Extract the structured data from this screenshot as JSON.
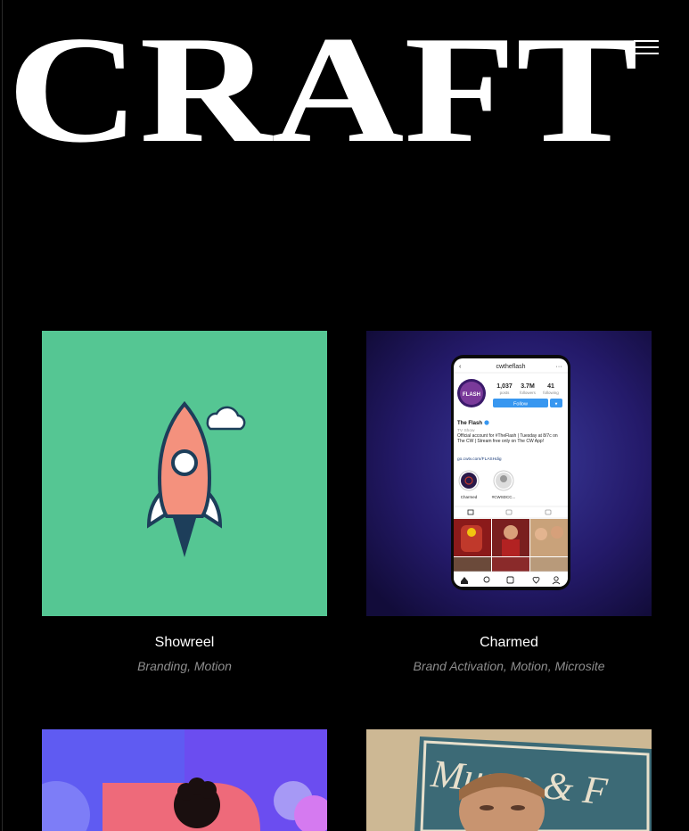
{
  "brand": {
    "name": "CRAFT"
  },
  "colors": {
    "background": "#000000",
    "showreel_bg": "#55c693",
    "charmed_bg": "#22185e",
    "card3_bg": "#6b4df0",
    "card4_bg": "#c9b79a"
  },
  "header": {
    "menu_icon": "hamburger-icon"
  },
  "projects": [
    {
      "title": "Showreel",
      "tags": "Branding, Motion",
      "icon": "rocket-icon"
    },
    {
      "title": "Charmed",
      "tags": "Brand Activation, Motion, Microsite",
      "phone": {
        "username": "cwtheflash",
        "posts_count": "1,037",
        "posts_label": "posts",
        "followers_count": "3.7M",
        "followers_label": "followers",
        "following_count": "41",
        "following_label": "following",
        "follow_button": "Follow",
        "name": "The Flash",
        "category": "TV Show",
        "bio": "Official account for #TheFlash | Tuesday at 8/7c on The CW | Stream free only on The CW App!",
        "link": "go.cwtv.com/FLASHdig",
        "highlights": [
          "Charmed",
          "#CWSDCC..."
        ],
        "avatar_text": "FLASH"
      }
    },
    {
      "title": "",
      "tags": ""
    },
    {
      "title": "",
      "tags": "",
      "sign_text": "Musso & F"
    }
  ]
}
